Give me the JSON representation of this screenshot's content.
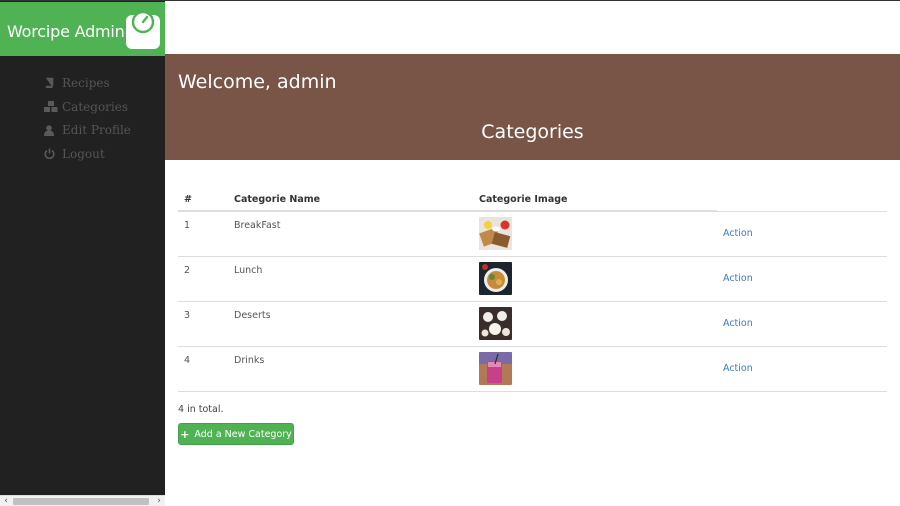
{
  "brand": {
    "title": "Worcipe Admin",
    "logo_icon": "scale-icon"
  },
  "sidebar": {
    "items": [
      {
        "label": "Recipes",
        "icon": "book-icon"
      },
      {
        "label": "Categories",
        "icon": "cubes-icon"
      },
      {
        "label": "Edit Profile",
        "icon": "user-icon"
      },
      {
        "label": "Logout",
        "icon": "power-icon"
      }
    ]
  },
  "header": {
    "welcome": "Welcome, admin",
    "section_title": "Categories"
  },
  "table": {
    "columns": [
      "#",
      "Categorie Name",
      "Categorie Image",
      ""
    ],
    "rows": [
      {
        "num": "1",
        "name": "BreakFast",
        "image": "breakfast-thumbnail",
        "action": "Action"
      },
      {
        "num": "2",
        "name": "Lunch",
        "image": "lunch-thumbnail",
        "action": "Action"
      },
      {
        "num": "3",
        "name": "Deserts",
        "image": "deserts-thumbnail",
        "action": "Action"
      },
      {
        "num": "4",
        "name": "Drinks",
        "image": "drinks-thumbnail",
        "action": "Action"
      }
    ]
  },
  "footer": {
    "total": "4 in total.",
    "add_button": "Add a New Category"
  },
  "colors": {
    "brand_green": "#4fb353",
    "hero_brown": "#795548",
    "sidebar_dark": "#212121",
    "link_blue": "#3b7bbf"
  }
}
